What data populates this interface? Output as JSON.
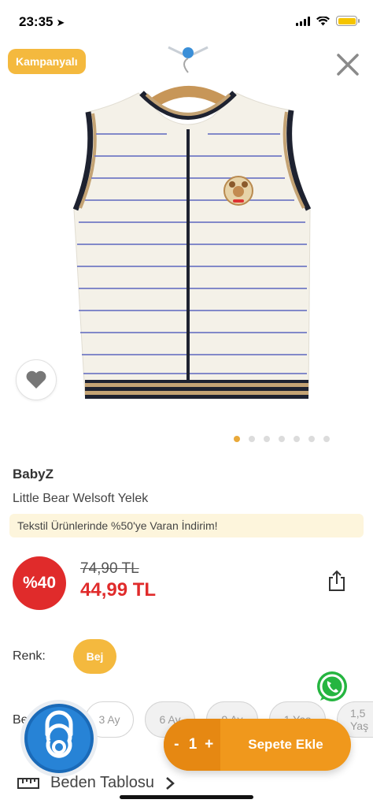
{
  "status": {
    "time": "23:35",
    "location_icon": "location-arrow-icon",
    "battery_color": "#f5c400"
  },
  "product": {
    "campaign_badge": "Kampanyalı",
    "gallery": {
      "dot_count": 7,
      "active_index": 0,
      "active_color": "#e9a93a"
    },
    "brand": "BabyZ",
    "name": "Little Bear Welsoft Yelek",
    "promo": "Tekstil Ürünlerinde %50'ye Varan İndirim!",
    "discount": "%40",
    "old_price": "74,90 TL",
    "new_price": "44,99 TL"
  },
  "color": {
    "label": "Renk:",
    "selected": "Bej",
    "chip_color": "#f4b93e"
  },
  "size": {
    "label": "Beden:",
    "options": [
      "3 Ay",
      "6 Ay",
      "9 Ay",
      "1 Yaş",
      "1,5 Yaş"
    ]
  },
  "size_table": {
    "label": "Beden Tablosu"
  },
  "cart": {
    "minus": "-",
    "quantity": "1",
    "plus": "+",
    "add_label": "Sepete Ekle",
    "color": "#f0981c"
  },
  "colors": {
    "accent": "#f4b93e",
    "price_red": "#e02b2b",
    "whatsapp": "#25b540"
  }
}
